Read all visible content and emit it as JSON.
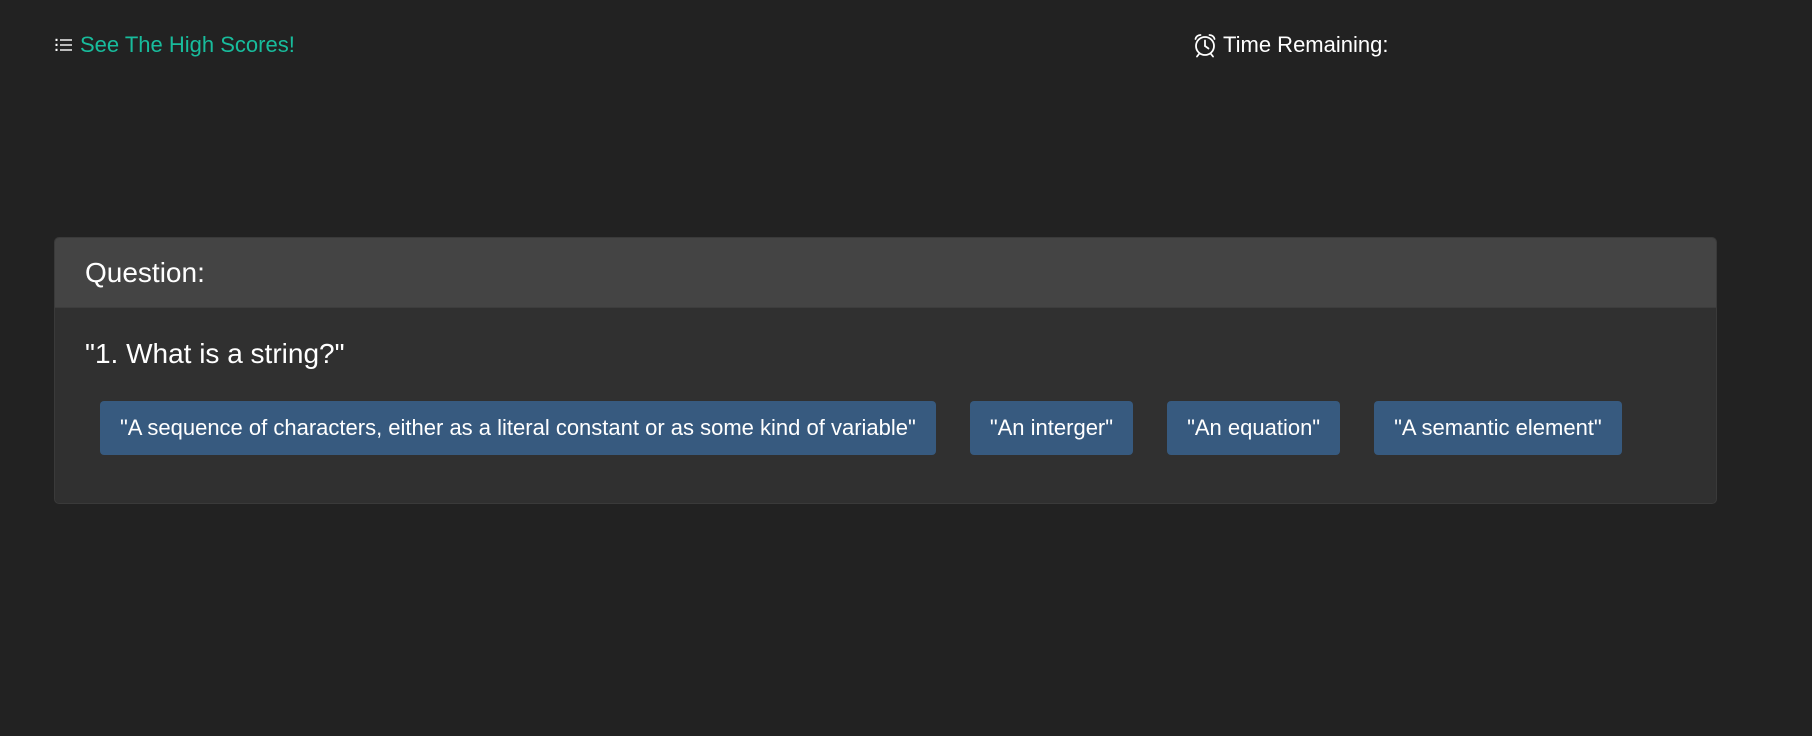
{
  "header": {
    "high_scores_link": "See The High Scores!",
    "high_scores_icon": "list-ol-icon",
    "timer_icon": "alarm-clock-icon",
    "timer_label": "Time Remaining:",
    "timer_value": ""
  },
  "quiz": {
    "card_title": "Question:",
    "question_text": "\"1. What is a string?\"",
    "answers": [
      "\"A sequence of characters, either as a literal constant or as some kind of variable\"",
      "\"An interger\"",
      "\"An equation\"",
      "\"A semantic element\""
    ]
  },
  "colors": {
    "background": "#222222",
    "card_header": "#444444",
    "card_body": "#303030",
    "link": "#18bc9c",
    "button": "#375a7f"
  }
}
